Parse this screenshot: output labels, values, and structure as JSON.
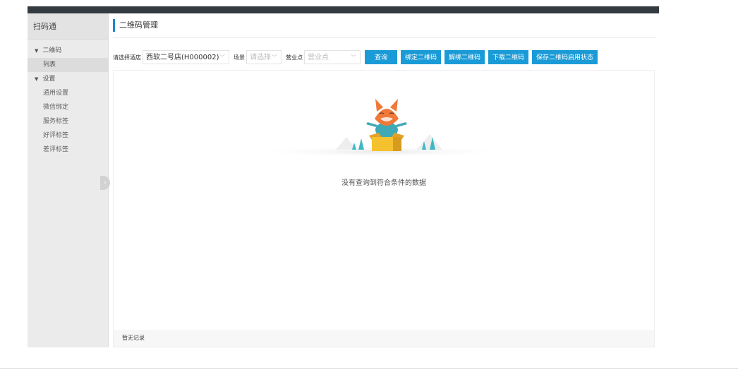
{
  "sidebar": {
    "title": "扫码通",
    "groups": [
      {
        "label": "二维码",
        "items": [
          "列表"
        ]
      },
      {
        "label": "设置",
        "items": [
          "通用设置",
          "微信绑定",
          "服务标签",
          "好评标签",
          "差评标签"
        ]
      }
    ],
    "collapse_glyph": "‹"
  },
  "page": {
    "title": "二维码管理"
  },
  "filters": {
    "hotel_label": "请选择酒店",
    "hotel_value": "西软二号店(H000002)",
    "scene_label": "场景",
    "scene_placeholder": "请选择",
    "outlet_label": "营业点",
    "outlet_placeholder": "营业点",
    "chevron": "﹀"
  },
  "buttons": {
    "query": "查询",
    "bind": "绑定二维码",
    "unbind": "解绑二维码",
    "download": "下载二维码",
    "save_status": "保存二维码启用状态"
  },
  "empty": {
    "message": "没有查询到符合条件的数据"
  },
  "footer": {
    "text": "暂无记录"
  },
  "colors": {
    "topbar": "#333a40",
    "accent": "#1a9bd7",
    "sidebar_bg": "#ebebeb"
  }
}
